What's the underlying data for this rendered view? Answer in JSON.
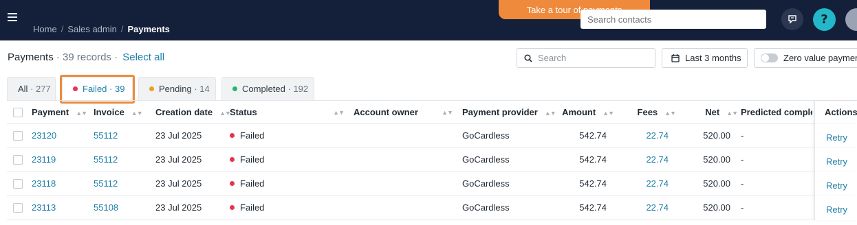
{
  "nav": {
    "breadcrumb": [
      "Home",
      "Sales admin",
      "Payments"
    ],
    "tour_label": "Take a tour of payments",
    "contact_search_placeholder": "Search contacts",
    "help_glyph": "?",
    "colors": {
      "bar": "#14203a",
      "tour": "#ef8a3c",
      "help": "#23b8c9"
    }
  },
  "toolbar": {
    "title": "Payments",
    "records": "· 39 records ·",
    "select_all": "Select all",
    "search_placeholder": "Search",
    "date_range": "Last 3 months",
    "zero_toggle": "Zero value payments"
  },
  "tabs": [
    {
      "label": "All",
      "count": "· 277",
      "dot": null,
      "active": false
    },
    {
      "label": "Failed",
      "count": "· 39",
      "dot": "#e8344e",
      "active": true
    },
    {
      "label": "Pending",
      "count": "· 14",
      "dot": "#e8a21a",
      "active": false
    },
    {
      "label": "Completed",
      "count": "· 192",
      "dot": "#22b573",
      "active": false
    }
  ],
  "table": {
    "columns": {
      "payment": "Payment",
      "invoice": "Invoice",
      "created": "Creation date",
      "status": "Status",
      "owner": "Account owner",
      "provider": "Payment provider",
      "amount": "Amount",
      "fees": "Fees",
      "net": "Net",
      "predicted": "Predicted completion",
      "actions": "Actions"
    },
    "rows": [
      {
        "payment": "23120",
        "invoice": "55112",
        "created": "23 Jul 2025",
        "status": "Failed",
        "owner": "",
        "provider": "GoCardless",
        "amount": "542.74",
        "fees": "22.74",
        "net": "520.00",
        "predicted": "-",
        "action": "Retry"
      },
      {
        "payment": "23119",
        "invoice": "55112",
        "created": "23 Jul 2025",
        "status": "Failed",
        "owner": "",
        "provider": "GoCardless",
        "amount": "542.74",
        "fees": "22.74",
        "net": "520.00",
        "predicted": "-",
        "action": "Retry"
      },
      {
        "payment": "23118",
        "invoice": "55112",
        "created": "23 Jul 2025",
        "status": "Failed",
        "owner": "",
        "provider": "GoCardless",
        "amount": "542.74",
        "fees": "22.74",
        "net": "520.00",
        "predicted": "-",
        "action": "Retry"
      },
      {
        "payment": "23113",
        "invoice": "55108",
        "created": "23 Jul 2025",
        "status": "Failed",
        "owner": "",
        "provider": "GoCardless",
        "amount": "542.74",
        "fees": "22.74",
        "net": "520.00",
        "predicted": "-",
        "action": "Retry"
      }
    ],
    "status_color": "#e8344e"
  }
}
